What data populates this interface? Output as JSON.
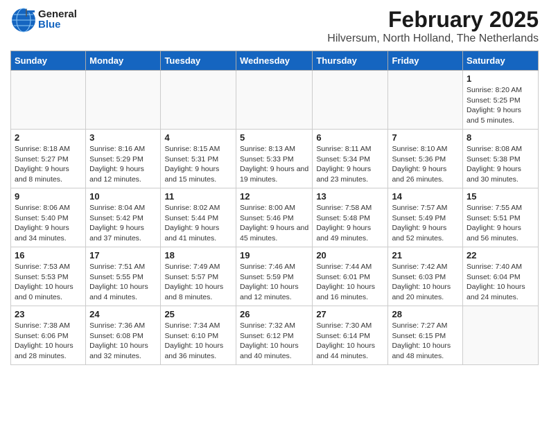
{
  "header": {
    "logo_general": "General",
    "logo_blue": "Blue",
    "title": "February 2025",
    "subtitle": "Hilversum, North Holland, The Netherlands"
  },
  "calendar": {
    "weekdays": [
      "Sunday",
      "Monday",
      "Tuesday",
      "Wednesday",
      "Thursday",
      "Friday",
      "Saturday"
    ],
    "weeks": [
      [
        {
          "day": "",
          "info": ""
        },
        {
          "day": "",
          "info": ""
        },
        {
          "day": "",
          "info": ""
        },
        {
          "day": "",
          "info": ""
        },
        {
          "day": "",
          "info": ""
        },
        {
          "day": "",
          "info": ""
        },
        {
          "day": "1",
          "info": "Sunrise: 8:20 AM\nSunset: 5:25 PM\nDaylight: 9 hours and 5 minutes."
        }
      ],
      [
        {
          "day": "2",
          "info": "Sunrise: 8:18 AM\nSunset: 5:27 PM\nDaylight: 9 hours and 8 minutes."
        },
        {
          "day": "3",
          "info": "Sunrise: 8:16 AM\nSunset: 5:29 PM\nDaylight: 9 hours and 12 minutes."
        },
        {
          "day": "4",
          "info": "Sunrise: 8:15 AM\nSunset: 5:31 PM\nDaylight: 9 hours and 15 minutes."
        },
        {
          "day": "5",
          "info": "Sunrise: 8:13 AM\nSunset: 5:33 PM\nDaylight: 9 hours and 19 minutes."
        },
        {
          "day": "6",
          "info": "Sunrise: 8:11 AM\nSunset: 5:34 PM\nDaylight: 9 hours and 23 minutes."
        },
        {
          "day": "7",
          "info": "Sunrise: 8:10 AM\nSunset: 5:36 PM\nDaylight: 9 hours and 26 minutes."
        },
        {
          "day": "8",
          "info": "Sunrise: 8:08 AM\nSunset: 5:38 PM\nDaylight: 9 hours and 30 minutes."
        }
      ],
      [
        {
          "day": "9",
          "info": "Sunrise: 8:06 AM\nSunset: 5:40 PM\nDaylight: 9 hours and 34 minutes."
        },
        {
          "day": "10",
          "info": "Sunrise: 8:04 AM\nSunset: 5:42 PM\nDaylight: 9 hours and 37 minutes."
        },
        {
          "day": "11",
          "info": "Sunrise: 8:02 AM\nSunset: 5:44 PM\nDaylight: 9 hours and 41 minutes."
        },
        {
          "day": "12",
          "info": "Sunrise: 8:00 AM\nSunset: 5:46 PM\nDaylight: 9 hours and 45 minutes."
        },
        {
          "day": "13",
          "info": "Sunrise: 7:58 AM\nSunset: 5:48 PM\nDaylight: 9 hours and 49 minutes."
        },
        {
          "day": "14",
          "info": "Sunrise: 7:57 AM\nSunset: 5:49 PM\nDaylight: 9 hours and 52 minutes."
        },
        {
          "day": "15",
          "info": "Sunrise: 7:55 AM\nSunset: 5:51 PM\nDaylight: 9 hours and 56 minutes."
        }
      ],
      [
        {
          "day": "16",
          "info": "Sunrise: 7:53 AM\nSunset: 5:53 PM\nDaylight: 10 hours and 0 minutes."
        },
        {
          "day": "17",
          "info": "Sunrise: 7:51 AM\nSunset: 5:55 PM\nDaylight: 10 hours and 4 minutes."
        },
        {
          "day": "18",
          "info": "Sunrise: 7:49 AM\nSunset: 5:57 PM\nDaylight: 10 hours and 8 minutes."
        },
        {
          "day": "19",
          "info": "Sunrise: 7:46 AM\nSunset: 5:59 PM\nDaylight: 10 hours and 12 minutes."
        },
        {
          "day": "20",
          "info": "Sunrise: 7:44 AM\nSunset: 6:01 PM\nDaylight: 10 hours and 16 minutes."
        },
        {
          "day": "21",
          "info": "Sunrise: 7:42 AM\nSunset: 6:03 PM\nDaylight: 10 hours and 20 minutes."
        },
        {
          "day": "22",
          "info": "Sunrise: 7:40 AM\nSunset: 6:04 PM\nDaylight: 10 hours and 24 minutes."
        }
      ],
      [
        {
          "day": "23",
          "info": "Sunrise: 7:38 AM\nSunset: 6:06 PM\nDaylight: 10 hours and 28 minutes."
        },
        {
          "day": "24",
          "info": "Sunrise: 7:36 AM\nSunset: 6:08 PM\nDaylight: 10 hours and 32 minutes."
        },
        {
          "day": "25",
          "info": "Sunrise: 7:34 AM\nSunset: 6:10 PM\nDaylight: 10 hours and 36 minutes."
        },
        {
          "day": "26",
          "info": "Sunrise: 7:32 AM\nSunset: 6:12 PM\nDaylight: 10 hours and 40 minutes."
        },
        {
          "day": "27",
          "info": "Sunrise: 7:30 AM\nSunset: 6:14 PM\nDaylight: 10 hours and 44 minutes."
        },
        {
          "day": "28",
          "info": "Sunrise: 7:27 AM\nSunset: 6:15 PM\nDaylight: 10 hours and 48 minutes."
        },
        {
          "day": "",
          "info": ""
        }
      ]
    ]
  }
}
